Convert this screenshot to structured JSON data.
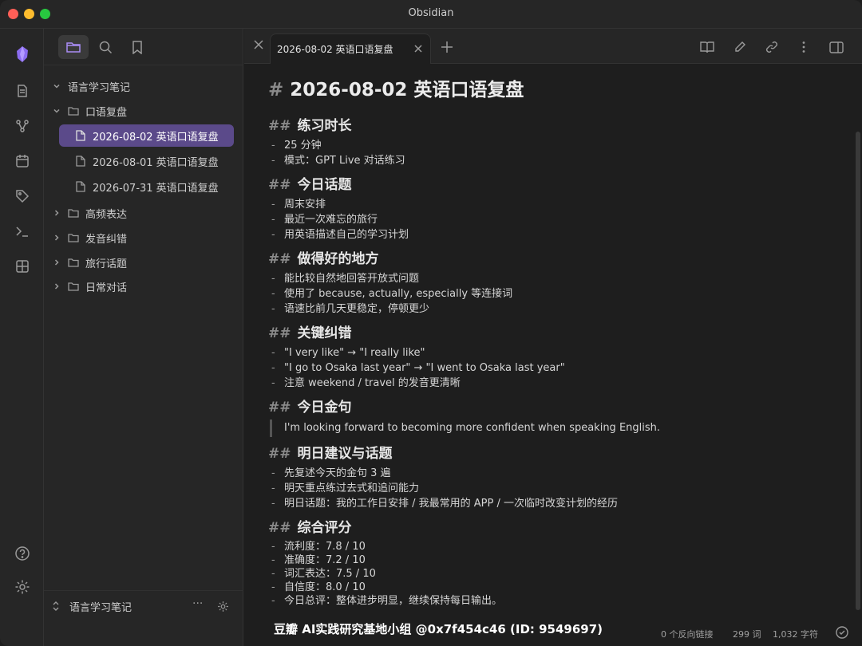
{
  "window": {
    "title": "Obsidian"
  },
  "sidebar": {
    "tree": [
      {
        "label": "语言学习笔记",
        "type": "root",
        "expanded": true
      },
      {
        "label": "口语复盘",
        "type": "folder",
        "expanded": true
      },
      {
        "label": "2026-08-02 英语口语复盘",
        "type": "file",
        "selected": true
      },
      {
        "label": "2026-08-01 英语口语复盘",
        "type": "file"
      },
      {
        "label": "2026-07-31 英语口语复盘",
        "type": "file"
      },
      {
        "label": "高频表达",
        "type": "folder",
        "expanded": false
      },
      {
        "label": "发音纠错",
        "type": "folder",
        "expanded": false
      },
      {
        "label": "旅行话题",
        "type": "folder",
        "expanded": false
      },
      {
        "label": "日常对话",
        "type": "folder",
        "expanded": false
      }
    ],
    "vault_name": "语言学习笔记",
    "more": "···"
  },
  "tab": {
    "title": "2026-08-02 英语口语复盘"
  },
  "doc": {
    "title": "2026-08-02 英语口语复盘",
    "h1_mark": "#",
    "h2_mark": "##",
    "sections": [
      {
        "heading": "练习时长",
        "items": [
          "25 分钟",
          "模式：GPT Live 对话练习"
        ]
      },
      {
        "heading": "今日话题",
        "items": [
          "周末安排",
          "最近一次难忘的旅行",
          "用英语描述自己的学习计划"
        ]
      },
      {
        "heading": "做得好的地方",
        "items": [
          "能比较自然地回答开放式问题",
          "使用了 because, actually, especially 等连接词",
          "语速比前几天更稳定，停顿更少"
        ]
      },
      {
        "heading": "关键纠错",
        "items": [
          "\"I very like\" → \"I really like\"",
          "\"I go to Osaka last year\" → \"I went to Osaka last year\"",
          "注意 weekend / travel 的发音更清晰"
        ]
      },
      {
        "heading": "今日金句",
        "quote": "I'm looking forward to becoming more confident when speaking English."
      },
      {
        "heading": "明日建议与话题",
        "items": [
          "先复述今天的金句 3 遍",
          "明天重点练过去式和追问能力",
          "明日话题：我的工作日安排 / 我最常用的 APP / 一次临时改变计划的经历"
        ]
      },
      {
        "heading": "综合评分",
        "items": [
          "流利度：7.8 / 10",
          "准确度：7.2 / 10",
          "词汇表达：7.5 / 10",
          "自信度：8.0 / 10",
          "今日总评：整体进步明显，继续保持每日输出。"
        ]
      }
    ],
    "dash": "-"
  },
  "status": {
    "backlinks": "0 个反向链接",
    "words": "299 词",
    "chars": "1,032 字符"
  },
  "watermark": "豆瓣  AI实践研究基地小组 @0x7f454c46 (ID: 9549697)",
  "colors": {
    "accent": "#7c5cd6",
    "selected": "#5b4a8a"
  }
}
